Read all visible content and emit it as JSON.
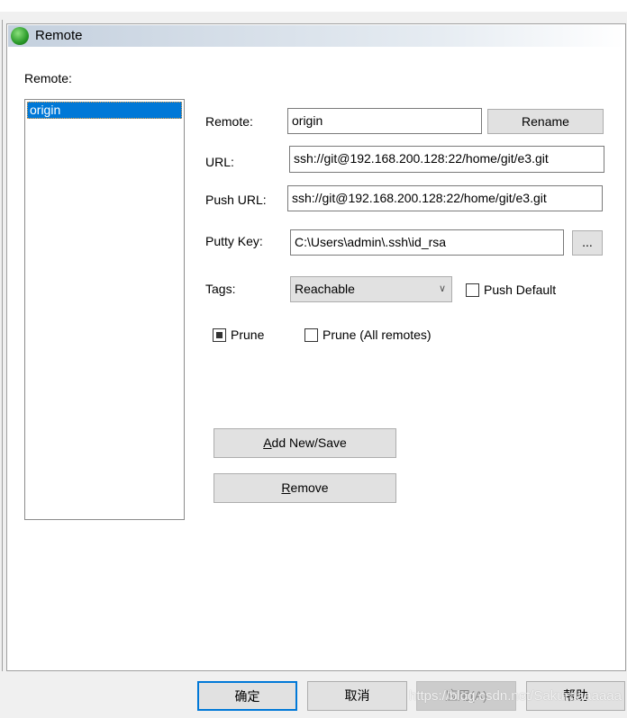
{
  "window": {
    "title": "Remote",
    "icon": "globe-icon"
  },
  "remote_list": {
    "label": "Remote:",
    "items": [
      "origin"
    ],
    "selected": "origin"
  },
  "form": {
    "remote_label": "Remote:",
    "remote_value": "origin",
    "rename_label": "Rename",
    "url_label": "URL:",
    "url_value": "ssh://git@192.168.200.128:22/home/git/e3.git",
    "push_url_label": "Push URL:",
    "push_url_value": "ssh://git@192.168.200.128:22/home/git/e3.git",
    "putty_label": "Putty Key:",
    "putty_value": "C:\\Users\\admin\\.ssh\\id_rsa",
    "browse_label": "...",
    "tags_label": "Tags:",
    "tags_value": "Reachable",
    "push_default_label": "Push Default",
    "push_default_checked": false,
    "prune_label": "Prune",
    "prune_checked": "indeterminate",
    "prune_all_label": "Prune (All remotes)",
    "prune_all_checked": false,
    "add_save_label_u": "A",
    "add_save_label_rest": "dd New/Save",
    "remove_label_u": "R",
    "remove_label_rest": "emove"
  },
  "footer": {
    "ok": "确定",
    "cancel": "取消",
    "apply": "应用(A)",
    "help": "帮助"
  },
  "watermark": "https://blog.csdn.net/Sakuraaaaaaa",
  "colors": {
    "selection": "#0078d7",
    "focus_border": "#0078d7"
  }
}
